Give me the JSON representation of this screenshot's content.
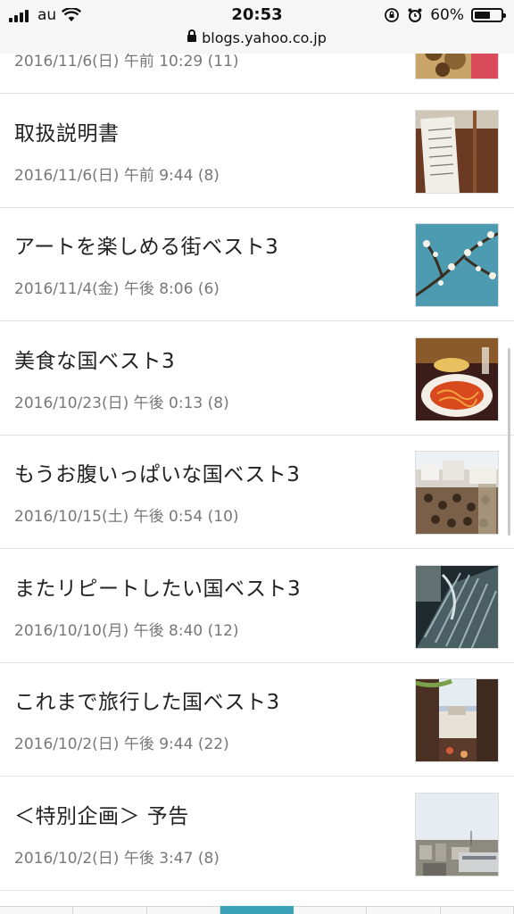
{
  "status": {
    "carrier": "au",
    "time": "20:53",
    "battery": "60%",
    "battery_level": 0.6,
    "url": "blogs.yahoo.co.jp"
  },
  "posts": [
    {
      "title": "",
      "meta": "2016/11/6(日) 午前 10:29 (11)"
    },
    {
      "title": "取扱説明書",
      "meta": "2016/11/6(日) 午前 9:44 (8)"
    },
    {
      "title": "アートを楽しめる街ベスト3",
      "meta": "2016/11/4(金) 午後 8:06 (6)"
    },
    {
      "title": "美食な国ベスト3",
      "meta": "2016/10/23(日) 午後 0:13 (8)"
    },
    {
      "title": "もうお腹いっぱいな国ベスト3",
      "meta": "2016/10/15(土) 午後 0:54 (10)"
    },
    {
      "title": "またリピートしたい国ベスト3",
      "meta": "2016/10/10(月) 午後 8:40 (12)"
    },
    {
      "title": "これまで旅行した国ベスト3",
      "meta": "2016/10/2(日) 午後 9:44 (22)"
    },
    {
      "title": "＜特別企画＞ 予告",
      "meta": "2016/10/2(日) 午後 3:47 (8)"
    }
  ],
  "colors": {
    "accent": "#3aa3b8",
    "meta_text": "#777777",
    "divider": "#e2e2e2"
  }
}
